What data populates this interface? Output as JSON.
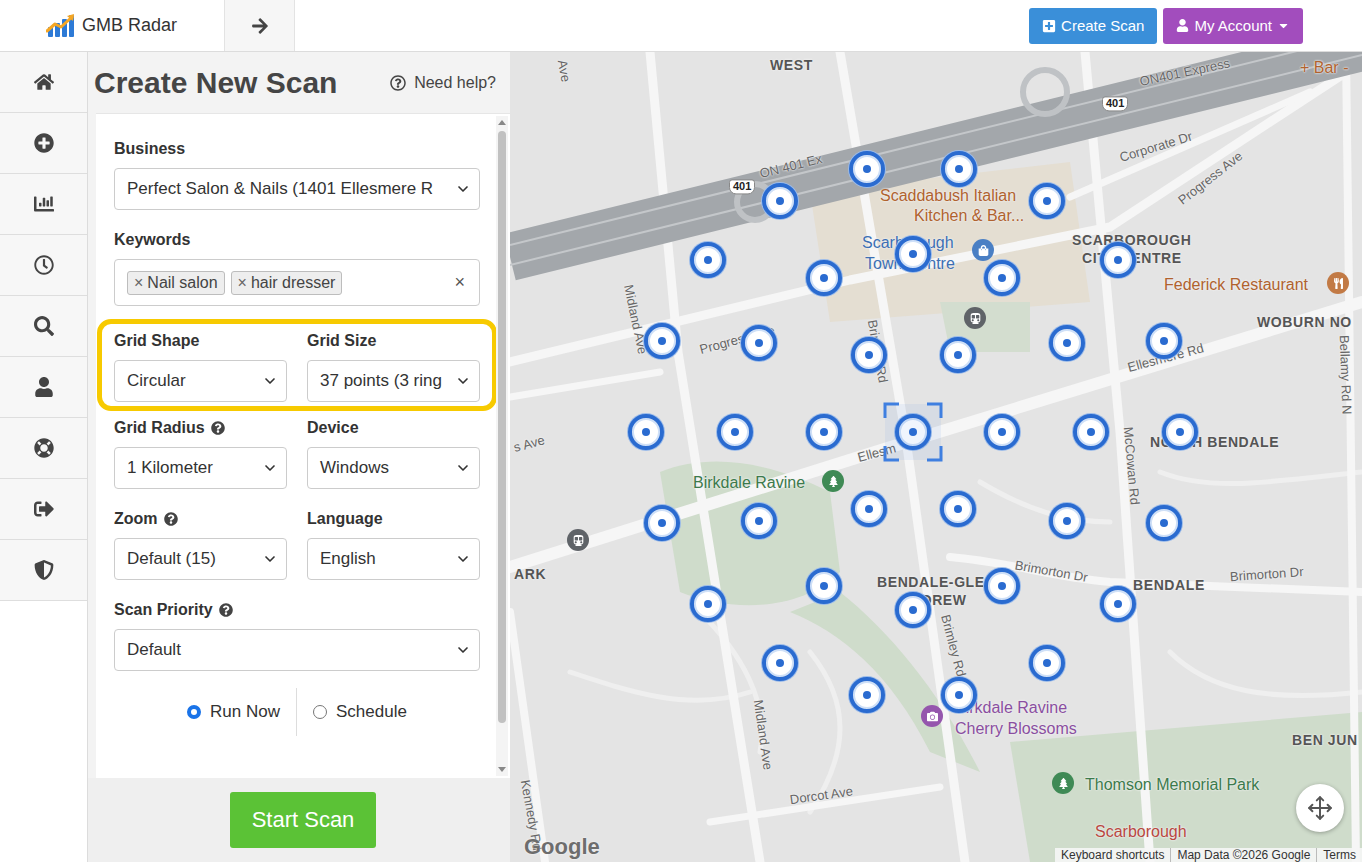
{
  "header": {
    "brand": "GMB Radar",
    "buttons": [
      {
        "label": "Create Scan",
        "kind": "create"
      },
      {
        "label": "My Account",
        "kind": "account"
      }
    ]
  },
  "form": {
    "title": "Create New Scan",
    "help": "Need help?",
    "business": {
      "label": "Business",
      "value": "Perfect Salon & Nails (1401 Ellesmere R"
    },
    "keywords": {
      "label": "Keywords",
      "tags": [
        {
          "remove": "×",
          "text": "Nail salon"
        },
        {
          "remove": "×",
          "text": "hair dresser"
        }
      ],
      "clear": "×"
    },
    "rows": [
      {
        "highlighted": true,
        "fields": [
          {
            "label": "Grid Shape",
            "value": "Circular",
            "help": false
          },
          {
            "label": "Grid Size",
            "value": "37 points (3 ring",
            "help": false
          }
        ]
      },
      {
        "highlighted": false,
        "fields": [
          {
            "label": "Grid Radius",
            "value": "1 Kilometer",
            "help": true
          },
          {
            "label": "Device",
            "value": "Windows",
            "help": false
          }
        ]
      },
      {
        "highlighted": false,
        "fields": [
          {
            "label": "Zoom",
            "value": "Default (15)",
            "help": true
          },
          {
            "label": "Language",
            "value": "English",
            "help": false
          }
        ]
      },
      {
        "highlighted": false,
        "fields": [
          {
            "label": "Scan Priority",
            "value": "Default",
            "help": true
          }
        ]
      }
    ],
    "run_options": [
      {
        "label": "Run Now",
        "selected": true
      },
      {
        "label": "Schedule",
        "selected": false
      }
    ],
    "submit": "Start Scan"
  },
  "map": {
    "grid": {
      "rings": 3
    },
    "labels": [
      {
        "text": "Ave",
        "kind": "road"
      },
      {
        "text": "WEST",
        "kind": "district"
      },
      {
        "text": "401",
        "kind": "shield"
      },
      {
        "text": "ON 401 Ex",
        "kind": "road"
      },
      {
        "text": "401",
        "kind": "shield"
      },
      {
        "text": "ON401 Express",
        "kind": "road"
      },
      {
        "text": "+ Bar -",
        "kind": "poi_food"
      },
      {
        "text": "Scaddabush Italian",
        "kind": "poi_food"
      },
      {
        "text": "Kitchen & Bar...",
        "kind": "poi_food"
      },
      {
        "text": "Scarborough",
        "kind": "poi_shop"
      },
      {
        "text": "Town Centre",
        "kind": "poi_shop"
      },
      {
        "text": "Corporate Dr",
        "kind": "road"
      },
      {
        "text": "Progress Ave",
        "kind": "road"
      },
      {
        "text": "SCARBOROUGH",
        "kind": "district"
      },
      {
        "text": "CITY CENTRE",
        "kind": "district"
      },
      {
        "text": "Federick Restaurant",
        "kind": "poi_food"
      },
      {
        "text": "WOBURN NO",
        "kind": "district"
      },
      {
        "text": "Bellamy Rd N",
        "kind": "road"
      },
      {
        "text": "Progress Ave",
        "kind": "road"
      },
      {
        "text": "Midland Ave",
        "kind": "road"
      },
      {
        "text": "Brimley Rd",
        "kind": "road"
      },
      {
        "text": "Ellesmere Rd",
        "kind": "road"
      },
      {
        "text": "Ellesm",
        "kind": "road"
      },
      {
        "text": "s Ave",
        "kind": "road"
      },
      {
        "text": "NORTH BENDALE",
        "kind": "district"
      },
      {
        "text": "McCowan Rd",
        "kind": "road"
      },
      {
        "text": "Birkdale Ravine",
        "kind": "park"
      },
      {
        "text": "ARK",
        "kind": "district"
      },
      {
        "text": "Midland Ave",
        "kind": "road"
      },
      {
        "text": "BENDALE-GLEN",
        "kind": "district"
      },
      {
        "text": "ANDREW",
        "kind": "district"
      },
      {
        "text": "Brimorton Dr",
        "kind": "road"
      },
      {
        "text": "BENDALE",
        "kind": "district"
      },
      {
        "text": "Brimorton Dr",
        "kind": "road"
      },
      {
        "text": "Brimley Rd",
        "kind": "road"
      },
      {
        "text": "BEN JUN",
        "kind": "district"
      },
      {
        "text": "Birkdale Ravine",
        "kind": "poi_photo"
      },
      {
        "text": "Cherry Blossoms",
        "kind": "poi_photo"
      },
      {
        "text": "Thomson Memorial Park",
        "kind": "park"
      },
      {
        "text": "Dorcot Ave",
        "kind": "road"
      },
      {
        "text": "Kennedy Rd",
        "kind": "road"
      },
      {
        "text": "Scarborough",
        "kind": "poi_red"
      }
    ],
    "logo": "Google",
    "attribution": [
      "Keyboard shortcuts",
      "Map Data ©2026 Google",
      "Terms"
    ]
  }
}
